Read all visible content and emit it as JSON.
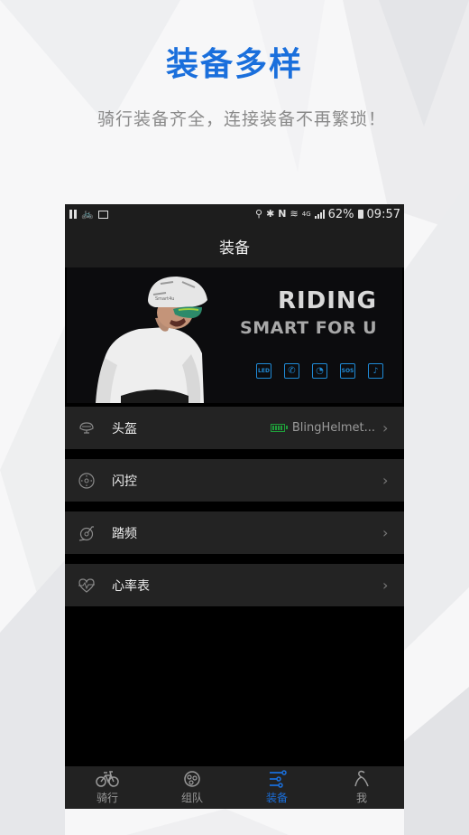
{
  "promo": {
    "title": "装备多样",
    "subtitle": "骑行装备齐全，连接装备不再繁琐！"
  },
  "status_bar": {
    "battery": "62%",
    "time": "09:57",
    "network": "4G"
  },
  "nav": {
    "title": "装备"
  },
  "banner": {
    "headline": "RIDING",
    "tagline": "SMART FOR U",
    "features": [
      "LED",
      "call",
      "speed",
      "SOS",
      "voice"
    ]
  },
  "devices": [
    {
      "label": "头盔",
      "icon": "helmet-icon",
      "value": "BlingHelmet...",
      "connected": true
    },
    {
      "label": "闪控",
      "icon": "remote-control-icon",
      "value": ""
    },
    {
      "label": "踏频",
      "icon": "cadence-icon",
      "value": ""
    },
    {
      "label": "心率表",
      "icon": "heart-rate-icon",
      "value": ""
    }
  ],
  "tabs": [
    {
      "label": "骑行",
      "icon": "bicycle-icon",
      "active": false
    },
    {
      "label": "组队",
      "icon": "team-icon",
      "active": false
    },
    {
      "label": "装备",
      "icon": "equipment-icon",
      "active": true
    },
    {
      "label": "我",
      "icon": "profile-icon",
      "active": false
    }
  ],
  "colors": {
    "accent": "#1a6fdc",
    "feature_icon": "#1f8ad6",
    "battery_green": "#1f9e3a"
  }
}
